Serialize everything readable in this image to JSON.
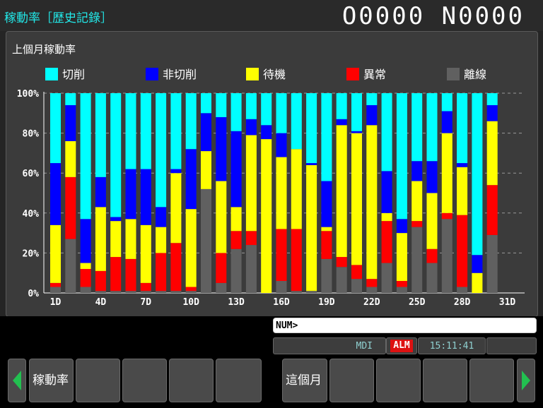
{
  "header": {
    "title": "稼動率［歴史記錄］",
    "counter": "O0000  N0000"
  },
  "panel": {
    "chart_title": "上個月稼動率"
  },
  "chart_data": {
    "type": "bar",
    "stacked": true,
    "title": "上個月稼動率",
    "ylim": [
      0,
      100
    ],
    "y_ticks": [
      "0%",
      "20%",
      "40%",
      "60%",
      "80%",
      "100%"
    ],
    "x_ticks": [
      "1D",
      "4D",
      "7D",
      "10D",
      "13D",
      "16D",
      "19D",
      "22D",
      "25D",
      "28D",
      "31D"
    ],
    "legend_position": "top",
    "grid": true,
    "categories": [
      "1D",
      "2D",
      "3D",
      "4D",
      "5D",
      "6D",
      "7D",
      "8D",
      "9D",
      "10D",
      "11D",
      "12D",
      "13D",
      "14D",
      "15D",
      "16D",
      "17D",
      "18D",
      "19D",
      "20D",
      "21D",
      "22D",
      "23D",
      "24D",
      "25D",
      "26D",
      "27D",
      "28D",
      "29D",
      "30D"
    ],
    "series": [
      {
        "name": "離線",
        "color": "#606060",
        "values": [
          3,
          27,
          3,
          1,
          1,
          1,
          1,
          1,
          1,
          1,
          52,
          5,
          22,
          24,
          0,
          6,
          1,
          1,
          17,
          13,
          7,
          3,
          15,
          3,
          33,
          15,
          37,
          3,
          0,
          29
        ]
      },
      {
        "name": "異常",
        "color": "#ff0000",
        "values": [
          2,
          31,
          9,
          10,
          17,
          16,
          4,
          19,
          24,
          2,
          0,
          15,
          9,
          7,
          0,
          26,
          31,
          0,
          14,
          5,
          7,
          4,
          21,
          3,
          3,
          7,
          3,
          36,
          0,
          25
        ]
      },
      {
        "name": "待機",
        "color": "#ffff00",
        "values": [
          29,
          18,
          3,
          32,
          18,
          20,
          29,
          13,
          35,
          39,
          19,
          36,
          12,
          48,
          77,
          36,
          40,
          63,
          2,
          66,
          66,
          77,
          4,
          24,
          20,
          28,
          40,
          24,
          10,
          32
        ]
      },
      {
        "name": "非切削",
        "color": "#0000ff",
        "values": [
          31,
          18,
          22,
          15,
          2,
          25,
          28,
          10,
          2,
          30,
          19,
          32,
          38,
          8,
          7,
          12,
          0,
          1,
          23,
          3,
          1,
          10,
          21,
          7,
          10,
          16,
          11,
          2,
          9,
          8
        ]
      },
      {
        "name": "切削",
        "color": "#00ffff",
        "values": [
          35,
          6,
          63,
          42,
          62,
          38,
          38,
          57,
          38,
          28,
          10,
          12,
          19,
          13,
          16,
          20,
          28,
          35,
          44,
          13,
          19,
          6,
          39,
          63,
          34,
          34,
          9,
          35,
          81,
          6
        ]
      }
    ]
  },
  "cmd": {
    "prompt": "NUM>"
  },
  "status": {
    "mode": "MDI",
    "alarm": "ALM",
    "time": "15:11:41"
  },
  "softkeys": {
    "left_label": "稼動率",
    "right_label": "這個月"
  },
  "colors": {
    "title_cyan": "#22e8e8",
    "alarm_red": "#dd1111",
    "arrow_green": "#22c050"
  }
}
